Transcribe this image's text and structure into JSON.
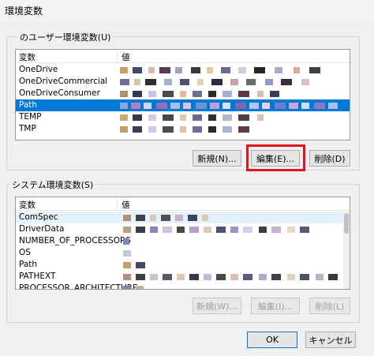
{
  "window": {
    "title": "環境変数"
  },
  "user_section": {
    "legend": "のユーザー環境変数(U)",
    "columns": [
      "変数",
      "値"
    ],
    "rows": [
      {
        "name": "OneDrive",
        "selected": false
      },
      {
        "name": "OneDriveCommercial",
        "selected": false
      },
      {
        "name": "OneDriveConsumer",
        "selected": false
      },
      {
        "name": "Path",
        "selected": true
      },
      {
        "name": "TEMP",
        "selected": false
      },
      {
        "name": "TMP",
        "selected": false
      }
    ],
    "buttons": {
      "new": "新規(N)...",
      "edit": "編集(E)...",
      "delete": "削除(D)"
    }
  },
  "system_section": {
    "legend": "システム環境変数(S)",
    "columns": [
      "変数",
      "値"
    ],
    "rows": [
      {
        "name": "ComSpec",
        "hover": true
      },
      {
        "name": "DriverData",
        "hover": false
      },
      {
        "name": "NUMBER_OF_PROCESSORS",
        "hover": false
      },
      {
        "name": "OS",
        "hover": false
      },
      {
        "name": "Path",
        "hover": false
      },
      {
        "name": "PATHEXT",
        "hover": false
      },
      {
        "name": "PROCESSOR_ARCHITECTURE",
        "hover": false
      }
    ],
    "buttons": {
      "new": "新規(W)...",
      "edit": "編集(I)...",
      "delete": "削除(L)"
    }
  },
  "footer": {
    "ok": "OK",
    "cancel": "キャンセル"
  },
  "colors": {
    "accent": "#0078d7",
    "highlight": "#e0141e"
  }
}
